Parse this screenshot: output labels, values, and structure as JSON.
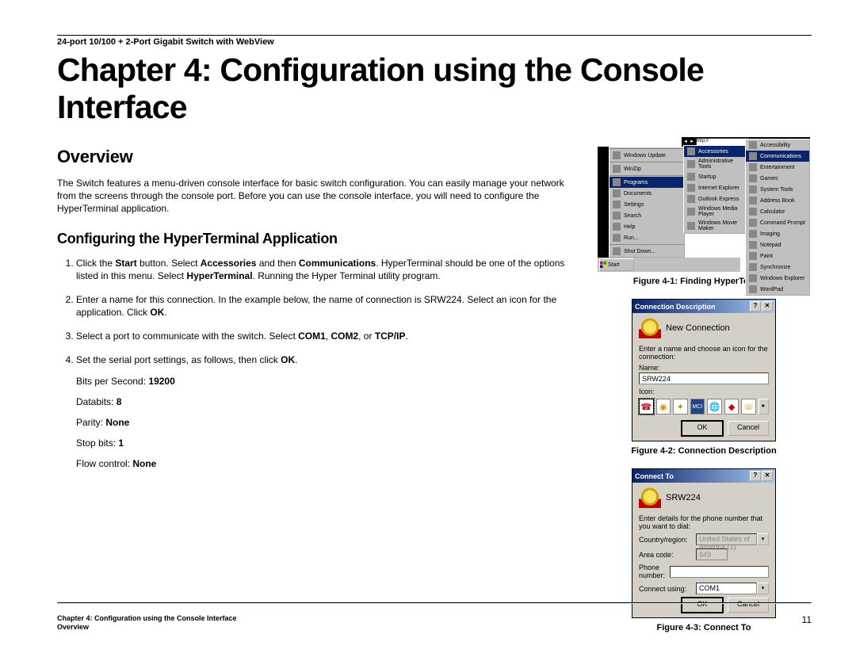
{
  "header": {
    "product": "24-port 10/100 + 2-Port Gigabit Switch with WebView"
  },
  "chapter_title": "Chapter 4: Configuration using the Console Interface",
  "section_overview": "Overview",
  "overview_para": "The Switch features a menu-driven console interface for basic switch configuration. You can easily manage your network from the screens through the console port. Before you can use the console interface, you will need to configure the HyperTerminal application.",
  "subsection_hyper": "Configuring the HyperTerminal Application",
  "steps": {
    "s1a": "Click the ",
    "s1b": "Start",
    "s1c": " button. Select ",
    "s1d": "Accessories",
    "s1e": " and then ",
    "s1f": "Communications",
    "s1g": ". HyperTerminal should be one of the options listed in this menu. Select ",
    "s1h": "HyperTerminal",
    "s1i": ". Running the Hyper Terminal utility program.",
    "s2a": "Enter a name for this connection. In the example below, the name of connection is SRW224. Select an icon for the application. Click ",
    "s2b": "OK",
    "s2c": ".",
    "s3a": "Select a port to communicate with the switch. Select ",
    "s3b": "COM1",
    "s3c": ", ",
    "s3d": "COM2",
    "s3e": ", or ",
    "s3f": "TCP/IP",
    "s3g": ".",
    "s4a": "Set the serial port settings, as follows, then click ",
    "s4b": "OK",
    "s4c": "."
  },
  "settings": {
    "bps_label": "Bits per Second: ",
    "bps_value": "19200",
    "databits_label": "Databits: ",
    "databits_value": "8",
    "parity_label": "Parity: ",
    "parity_value": "None",
    "stopbits_label": "Stop bits: ",
    "stopbits_value": "1",
    "flow_label": "Flow control: ",
    "flow_value": "None"
  },
  "figures": {
    "f1_caption": "Figure 4-1: Finding HyperTerminal",
    "f2_caption": "Figure 4-2: Connection Description",
    "f3_caption": "Figure 4-3: Connect To"
  },
  "fig41": {
    "start": "Start",
    "menu1": [
      "",
      "Windows Update",
      "",
      "WinZip",
      "",
      "Programs",
      "Documents",
      "Settings",
      "Search",
      "Help",
      "Run...",
      "",
      "Shut Down..."
    ],
    "programs_index": 5,
    "menu2": [
      "Accessories",
      "Administrative Tools",
      "Startup",
      "Internet Explorer",
      "Outlook Express",
      "Windows Media Player",
      "Windows Movie Maker"
    ],
    "accessories_index": 0,
    "menu3": [
      "Accessibility",
      "Communications",
      "Entertainment",
      "Games",
      "System Tools",
      "Address Book",
      "Calculator",
      "Command Prompt",
      "Imaging",
      "Notepad",
      "Paint",
      "Synchronize",
      "Windows Explorer",
      "WordPad"
    ],
    "comm_index": 1,
    "addr_placeholder": "http://"
  },
  "fig42": {
    "title": "Connection Description",
    "newconn": "New Connection",
    "prompt": "Enter a name and choose an icon for the connection:",
    "name_label": "Name:",
    "name_value": "SRW224",
    "icon_label": "Icon:",
    "ok": "OK",
    "cancel": "Cancel"
  },
  "fig43": {
    "title": "Connect To",
    "conn_name": "SRW224",
    "prompt": "Enter details for the phone number that you want to dial:",
    "country_label": "Country/region:",
    "country_value": "United States of America (1)",
    "area_label": "Area code:",
    "area_value": "949",
    "phone_label": "Phone number:",
    "phone_value": "",
    "using_label": "Connect using:",
    "using_value": "COM1",
    "ok": "OK",
    "cancel": "Cancel"
  },
  "footer": {
    "l1": "Chapter 4: Configuration using the Console Interface",
    "l2": "Overview",
    "page": "11"
  }
}
